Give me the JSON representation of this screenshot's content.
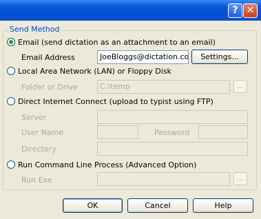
{
  "titlebar": {
    "help_label": "?",
    "close_label": "✕"
  },
  "send_method": {
    "legend": "Send Method",
    "email": {
      "label": "Email (send dictation as an attachment to an email)",
      "selected": true,
      "address_label": "Email Address",
      "address_value": "JoeBloggs@dictation.com",
      "settings_label": "Settings..."
    },
    "lan": {
      "label": "Local Area Network (LAN) or Floppy Disk",
      "folder_label": "Folder or Drive",
      "folder_value": "C:\\temp",
      "browse_label": "..."
    },
    "ftp": {
      "label": "Direct Internet Connect (upload to typist using FTP)",
      "server_label": "Server",
      "server_value": "",
      "user_label": "User Name",
      "user_value": "",
      "password_label": "Password",
      "password_value": "",
      "directory_label": "Directory",
      "directory_value": ""
    },
    "cmd": {
      "label": "Run Command Line Process (Advanced Option)",
      "exe_label": "Run Exe",
      "exe_value": "",
      "browse_label": "..."
    }
  },
  "footer": {
    "ok_label": "OK",
    "cancel_label": "Cancel",
    "help_label": "Help"
  }
}
